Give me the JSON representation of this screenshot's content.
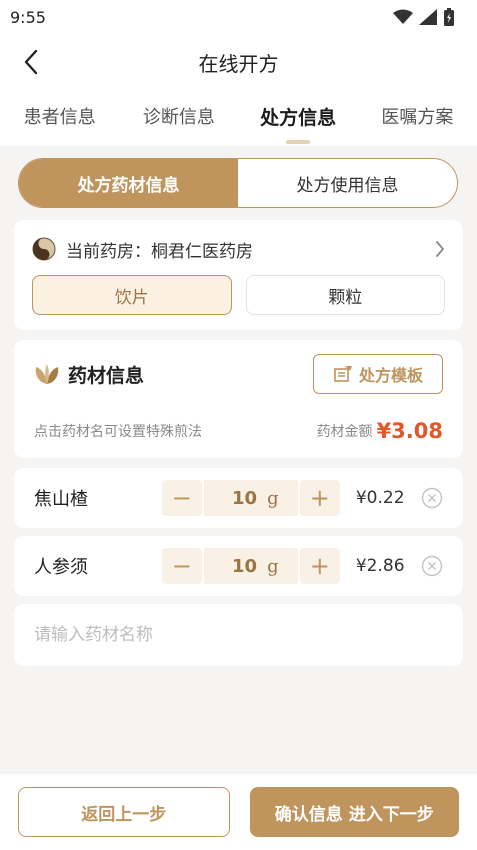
{
  "status_bar": {
    "time": "9:55",
    "icons": [
      "wifi-icon",
      "signal-icon",
      "battery-icon"
    ]
  },
  "nav": {
    "title": "在线开方",
    "back_icon": "chevron-left-icon"
  },
  "tabs": [
    {
      "label": "患者信息",
      "active": false
    },
    {
      "label": "诊断信息",
      "active": false
    },
    {
      "label": "处方信息",
      "active": true
    },
    {
      "label": "医嘱方案",
      "active": false
    }
  ],
  "segment": {
    "left": "处方药材信息",
    "right": "处方使用信息",
    "active": "left"
  },
  "pharmacy": {
    "label": "当前药房",
    "separator": "：",
    "name": "桐君仁医药房",
    "icon": "yin-yang-icon",
    "forms": [
      {
        "label": "饮片",
        "active": true
      },
      {
        "label": "颗粒",
        "active": false
      }
    ]
  },
  "herbs": {
    "title": "药材信息",
    "title_icon": "leaf-icon",
    "template_button": "处方模板",
    "template_icon": "notebook-icon",
    "hint": "点击药材名可设置特殊煎法",
    "amount_label": "药材金额",
    "amount_value": "¥3.08",
    "items": [
      {
        "name": "焦山楂",
        "qty": "10",
        "unit": "g",
        "price": "¥0.22"
      },
      {
        "name": "人参须",
        "qty": "10",
        "unit": "g",
        "price": "¥2.86"
      }
    ],
    "search_placeholder": "请输入药材名称"
  },
  "bottom": {
    "back": "返回上一步",
    "next": "确认信息 进入下一步"
  },
  "colors": {
    "accent": "#c0945d",
    "price_red": "#e0582c",
    "page_bg": "#f6f4f2"
  }
}
